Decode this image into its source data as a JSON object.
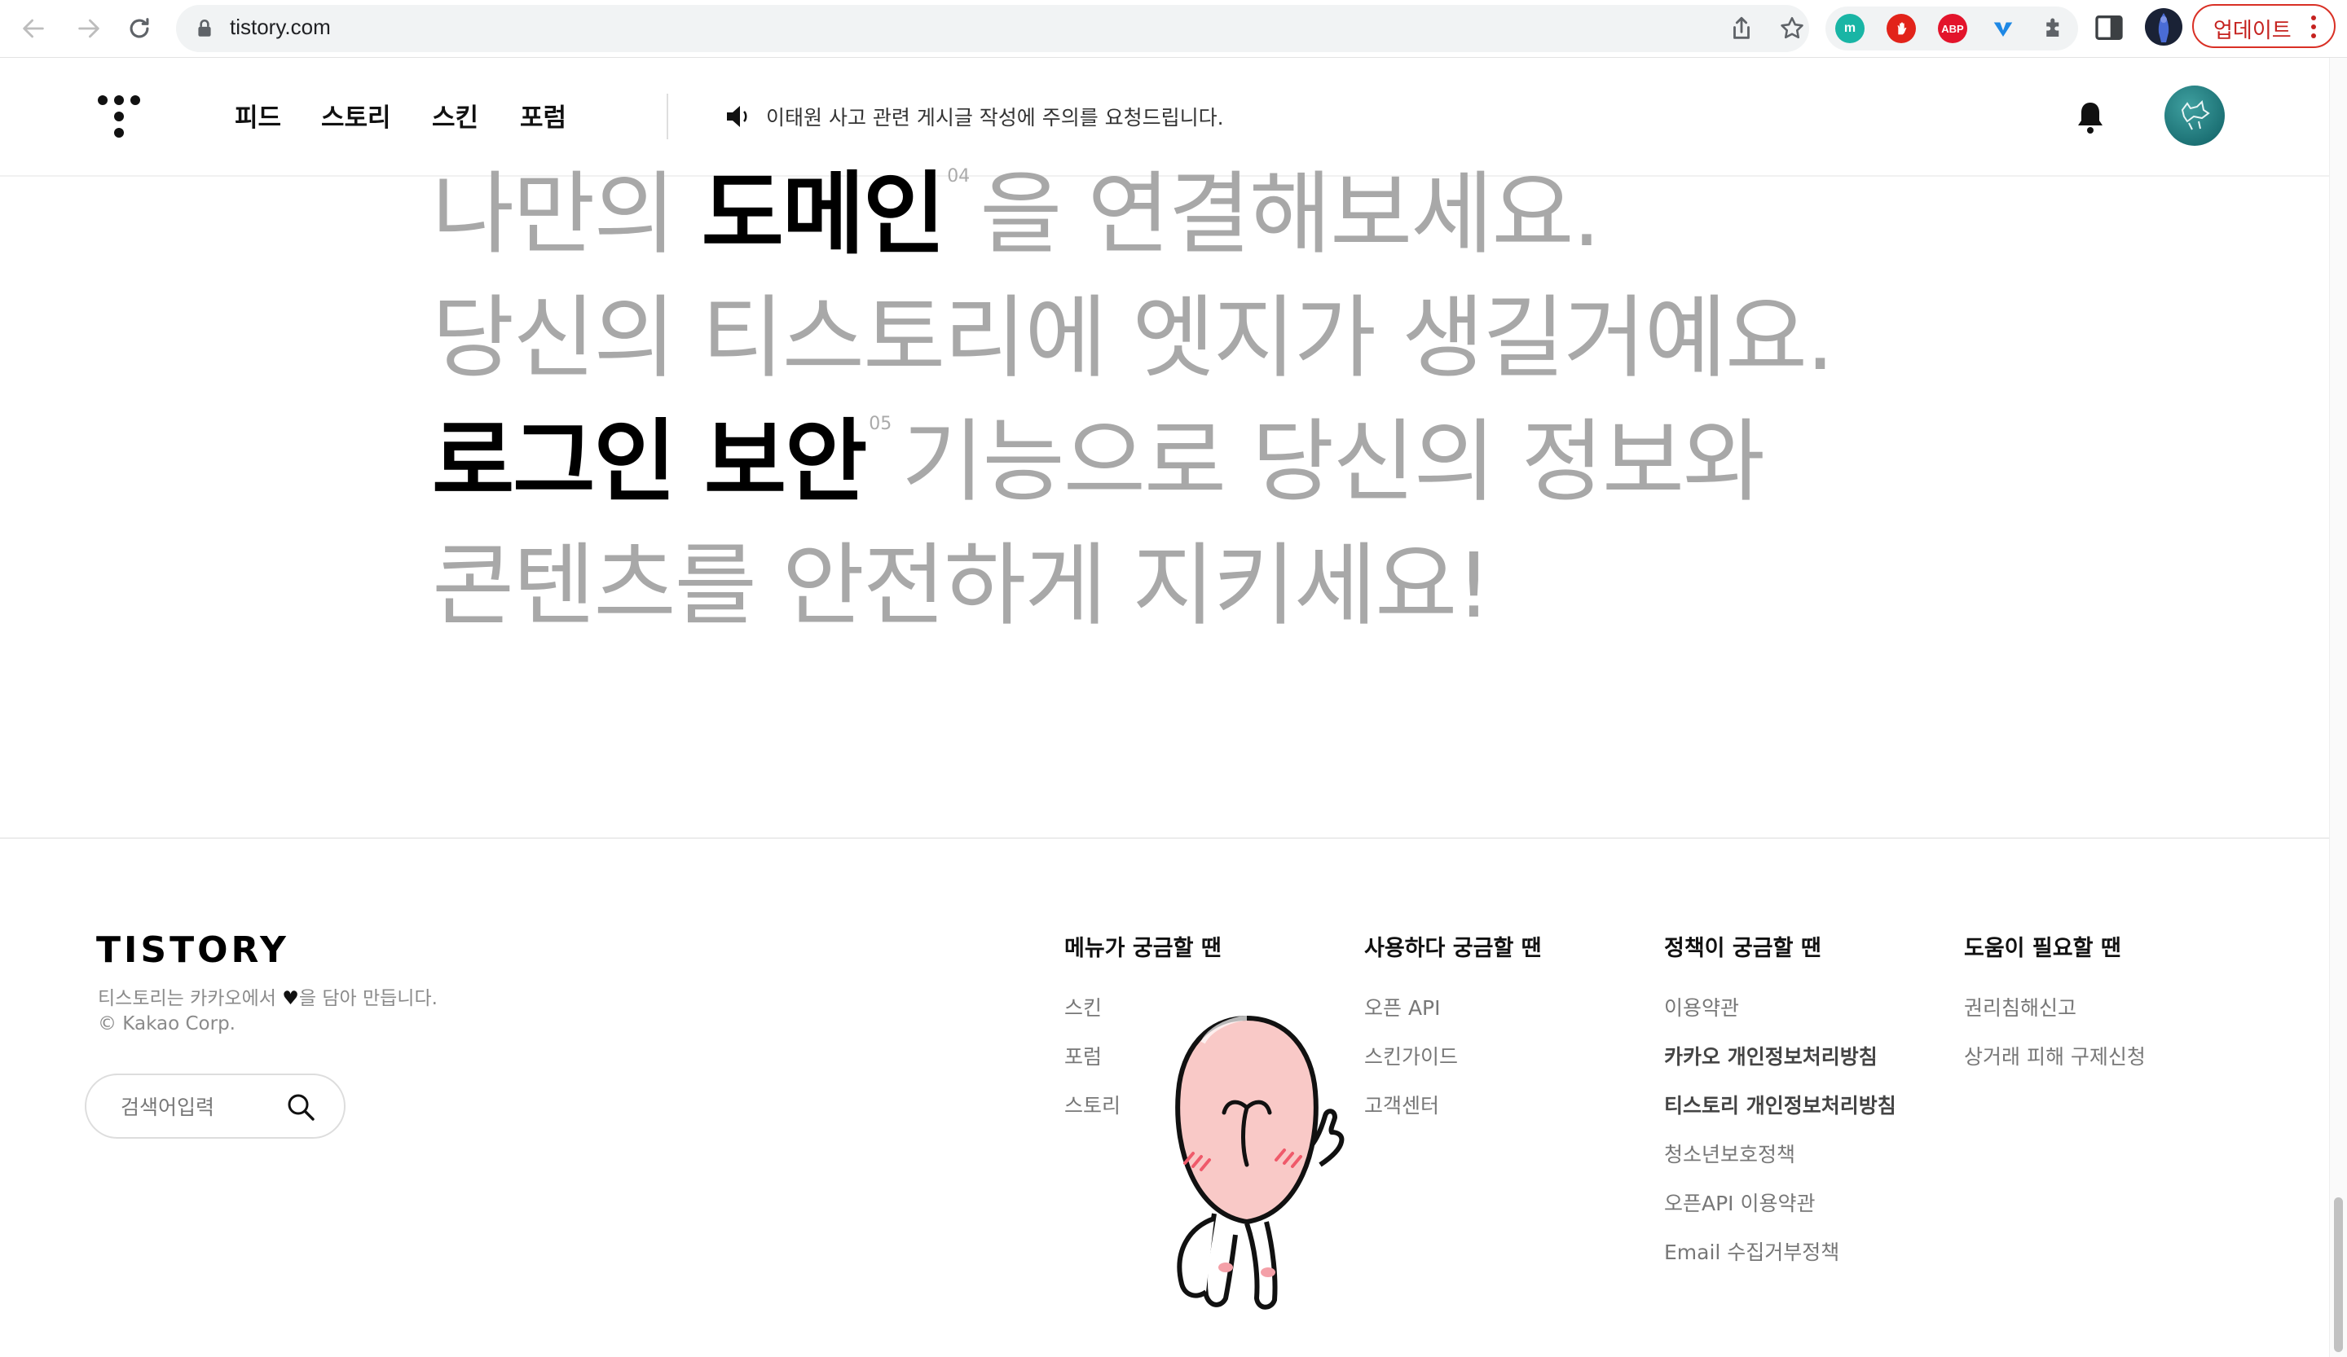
{
  "browser": {
    "url": "tistory.com",
    "update_label": "업데이트",
    "extensions": [
      {
        "name": "m",
        "color": "#19b5a5"
      },
      {
        "name": "",
        "color": "#e2231a"
      },
      {
        "name": "ABP",
        "color": "#e3142b"
      },
      {
        "name": "",
        "color": "#1e88e5"
      }
    ]
  },
  "header": {
    "nav": [
      "피드",
      "스토리",
      "스킨",
      "포럼"
    ],
    "notice": "이태원 사고 관련 게시글 작성에 주의를 요청드립니다."
  },
  "hero": {
    "line1_pre": "나만의 ",
    "line1_bold": "도메인",
    "line1_num": "04",
    "line1_post": "을 연결해보세요.",
    "line2": "당신의 티스토리에 엣지가 생길거예요.",
    "line3_bold": "로그인 보안",
    "line3_num": "05",
    "line3_post": "기능으로 당신의 정보와",
    "line4": "콘텐츠를 안전하게 지키세요!"
  },
  "footer": {
    "brand": "TISTORY",
    "tagline_pre": "티스토리는 카카오에서 ",
    "tagline_heart": "♥",
    "tagline_post": "을 담아 만듭니다.",
    "copyright": "© Kakao Corp.",
    "search_placeholder": "검색어입력",
    "columns": [
      {
        "title": "메뉴가 궁금할 땐",
        "links": [
          "스킨",
          "포럼",
          "스토리"
        ]
      },
      {
        "title": "사용하다 궁금할 땐",
        "links": [
          "오픈 API",
          "스킨가이드",
          "고객센터"
        ]
      },
      {
        "title": "정책이 궁금할 땐",
        "links": [
          "이용약관",
          "카카오 개인정보처리방침",
          "티스토리 개인정보처리방침",
          "청소년보호정책",
          "오픈API 이용약관",
          "Email 수집거부정책"
        ]
      },
      {
        "title": "도움이 필요할 땐",
        "links": [
          "권리침해신고",
          "상거래 피해 구제신청"
        ]
      }
    ]
  },
  "colors": {
    "hero_gray": "#a8a8a8",
    "update_red": "#c5221f",
    "avatar_teal": "#1b7a7d"
  }
}
